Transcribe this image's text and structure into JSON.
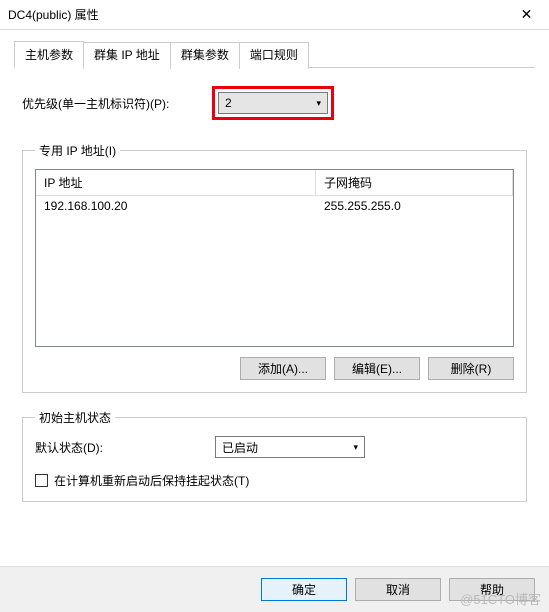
{
  "window": {
    "title": "DC4(public) 属性"
  },
  "tabs": {
    "items": [
      {
        "label": "主机参数",
        "active": true
      },
      {
        "label": "群集 IP 地址",
        "active": false
      },
      {
        "label": "群集参数",
        "active": false
      },
      {
        "label": "端口规则",
        "active": false
      }
    ]
  },
  "priority": {
    "label": "优先级(单一主机标识符)(P):",
    "value": "2"
  },
  "dedicated_ip": {
    "legend": "专用 IP 地址(I)",
    "columns": {
      "ip": "IP 地址",
      "mask": "子网掩码"
    },
    "rows": [
      {
        "ip": "192.168.100.20",
        "mask": "255.255.255.0"
      }
    ],
    "buttons": {
      "add": "添加(A)...",
      "edit": "编辑(E)...",
      "remove": "删除(R)"
    }
  },
  "initial_state": {
    "legend": "初始主机状态",
    "default_label": "默认状态(D):",
    "default_value": "已启动",
    "retain_label": "在计算机重新启动后保持挂起状态(T)",
    "retain_checked": false
  },
  "footer": {
    "ok": "确定",
    "cancel": "取消",
    "help": "帮助"
  },
  "watermark": "@51CTO博客"
}
